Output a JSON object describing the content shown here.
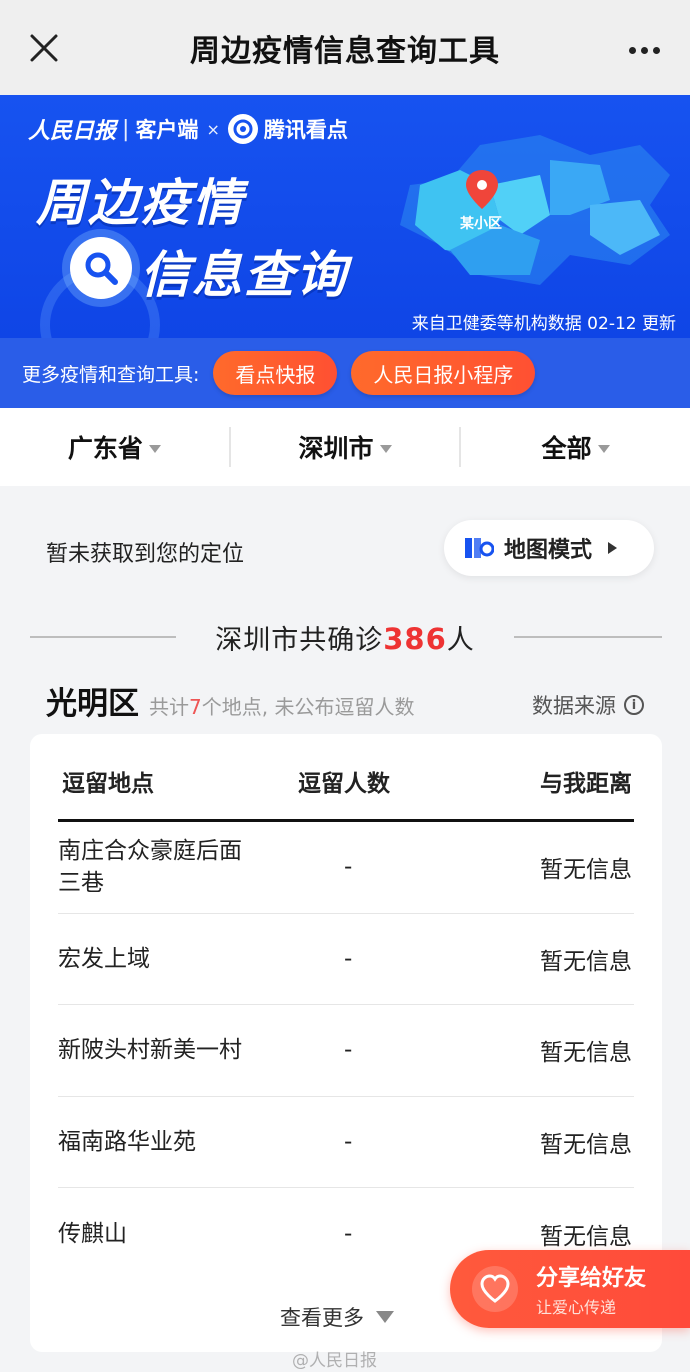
{
  "title_bar": {
    "title": "周边疫情信息查询工具",
    "close_icon": "close-icon",
    "more_icon": "more-dots-icon"
  },
  "banner": {
    "brand_rmrb": "人民日报",
    "brand_client": "客户端",
    "brand_x": "×",
    "brand_tencent": "腾讯看点",
    "headline_1": "周边疫情",
    "headline_2": "信息查询",
    "map_pin_label": "某小区",
    "source_note": "来自卫健委等机构数据  02-12 更新",
    "bg_color": "#1753f0"
  },
  "toolbar": {
    "label": "更多疫情和查询工具:",
    "buttons": [
      "看点快报",
      "人民日报小程序"
    ],
    "accent": "#ff5a32"
  },
  "filters": {
    "province": "广东省",
    "city": "深圳市",
    "scope": "全部"
  },
  "location": {
    "status": "暂未获取到您的定位",
    "map_mode_label": "地图模式"
  },
  "summary": {
    "prefix": "深圳市共确诊",
    "count": "386",
    "suffix": "人"
  },
  "district": {
    "name": "光明区",
    "sub_prefix": "共计",
    "sub_count": "7",
    "sub_suffix": "个地点, 未公布逗留人数",
    "data_source_label": "数据来源"
  },
  "table": {
    "headers": [
      "逗留地点",
      "逗留人数",
      "与我距离"
    ],
    "rows": [
      {
        "place": "南庄合众豪庭后面三巷",
        "count": "-",
        "distance": "暂无信息"
      },
      {
        "place": "宏发上域",
        "count": "-",
        "distance": "暂无信息"
      },
      {
        "place": "新陂头村新美一村",
        "count": "-",
        "distance": "暂无信息"
      },
      {
        "place": "福南路华业苑",
        "count": "-",
        "distance": "暂无信息"
      },
      {
        "place": "传麒山",
        "count": "-",
        "distance": "暂无信息"
      }
    ],
    "see_more": "查看更多"
  },
  "share": {
    "title": "分享给好友",
    "subtitle": "让爱心传递"
  },
  "watermark": "@人民日报"
}
